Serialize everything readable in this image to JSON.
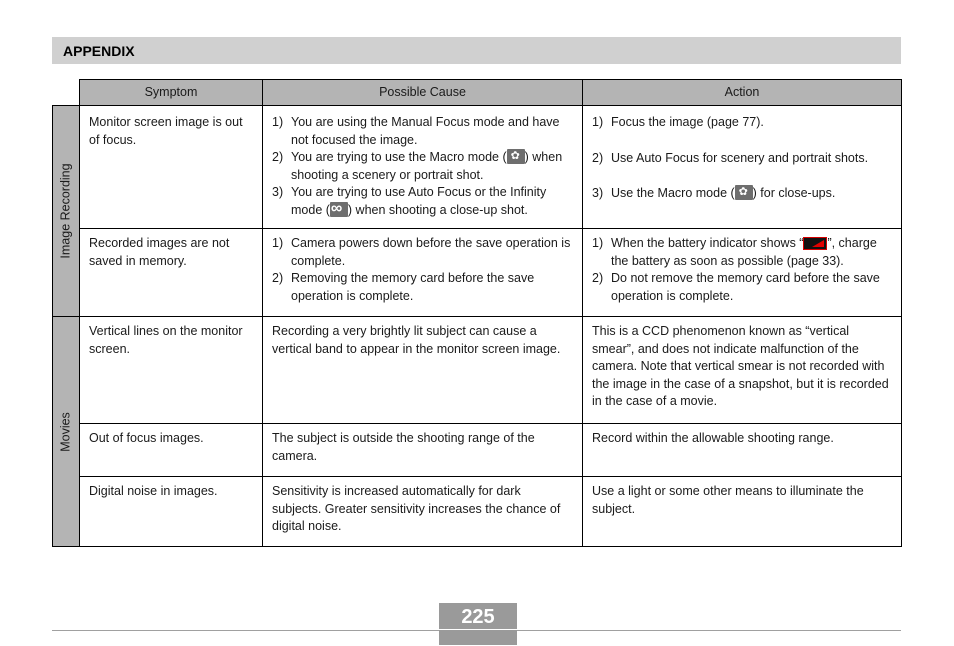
{
  "header": {
    "title": "APPENDIX"
  },
  "table": {
    "columns": [
      "Symptom",
      "Possible Cause",
      "Action"
    ],
    "categories": [
      "Image Recording",
      "Movies"
    ],
    "rows": [
      {
        "symptom": "Monitor screen image is out of focus.",
        "causes": [
          {
            "n": "1)",
            "text": "You are using the Manual Focus mode and have not focused the image."
          },
          {
            "n": "2)",
            "pre": "You are trying to use the Macro mode (",
            "icon": "macro-icon",
            "post": ") when shooting a scenery or portrait shot."
          },
          {
            "n": "3)",
            "pre": "You are trying to use Auto Focus or the Infinity mode (",
            "icon": "infinity-icon",
            "post": ") when shooting a close-up shot."
          }
        ],
        "actions": [
          {
            "n": "1)",
            "text": "Focus the image (page 77)."
          },
          {
            "n": "2)",
            "text": "Use Auto Focus for scenery and portrait shots."
          },
          {
            "n": "3)",
            "pre": "Use the Macro mode (",
            "icon": "macro-icon",
            "post": ") for close-ups."
          }
        ]
      },
      {
        "symptom": "Recorded images are not saved in memory.",
        "causes": [
          {
            "n": "1)",
            "text": "Camera powers down before the save operation is complete."
          },
          {
            "n": "2)",
            "text": "Removing the memory card before the save operation is complete."
          }
        ],
        "actions": [
          {
            "n": "1)",
            "pre": "When the battery indicator shows “",
            "icon": "battery-low-icon",
            "post": "”, charge the battery as soon as possible (page 33)."
          },
          {
            "n": "2)",
            "text": "Do not remove the memory card before the save operation is complete."
          }
        ]
      },
      {
        "symptom": "Vertical lines on the monitor screen.",
        "cause": "Recording a very brightly lit subject can cause a vertical band to appear in the monitor screen image.",
        "action": "This is a CCD phenomenon known as “vertical smear”, and does not indicate malfunction of the camera. Note that vertical smear is not recorded with the image in the case of a snapshot, but it is recorded in the case of a movie."
      },
      {
        "symptom": "Out of focus images.",
        "cause": "The subject is outside the shooting range of the camera.",
        "action": "Record within the allowable shooting range."
      },
      {
        "symptom": "Digital noise in images.",
        "cause": "Sensitivity is increased automatically for dark subjects. Greater sensitivity increases the chance of digital noise.",
        "action": "Use a light or some other means to illuminate the subject."
      }
    ]
  },
  "footer": {
    "page_number": "225"
  }
}
